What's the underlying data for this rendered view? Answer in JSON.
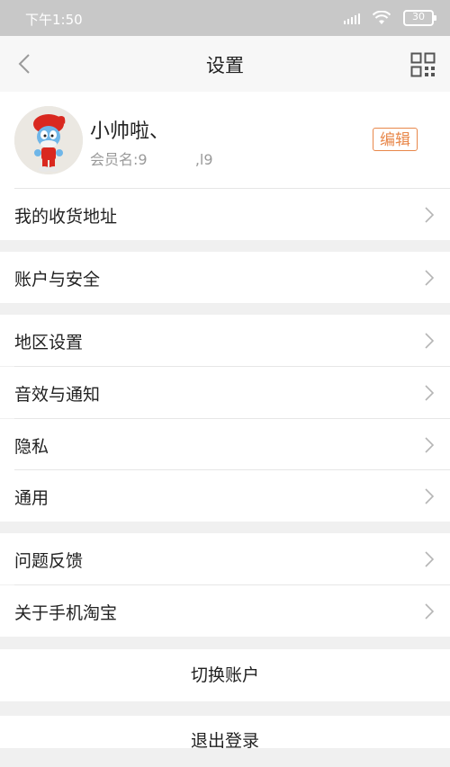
{
  "status_bar": {
    "time": "下午1:50",
    "battery": "30"
  },
  "nav": {
    "title": "设置"
  },
  "profile": {
    "name": "小帅啦、",
    "member_id": "会员名:9　　　 ,l9",
    "edit_label": "编辑"
  },
  "rows": [
    {
      "label": "我的收货地址"
    },
    {
      "label": "账户与安全"
    },
    {
      "label": "地区设置"
    },
    {
      "label": "音效与通知"
    },
    {
      "label": "隐私"
    },
    {
      "label": "通用"
    },
    {
      "label": "问题反馈"
    },
    {
      "label": "关于手机淘宝"
    }
  ],
  "actions": {
    "switch_account": "切换账户",
    "logout": "退出登录"
  },
  "colors": {
    "accent": "#e8874a",
    "background": "#f0f0f0",
    "status_bar": "#c8c8c8"
  }
}
